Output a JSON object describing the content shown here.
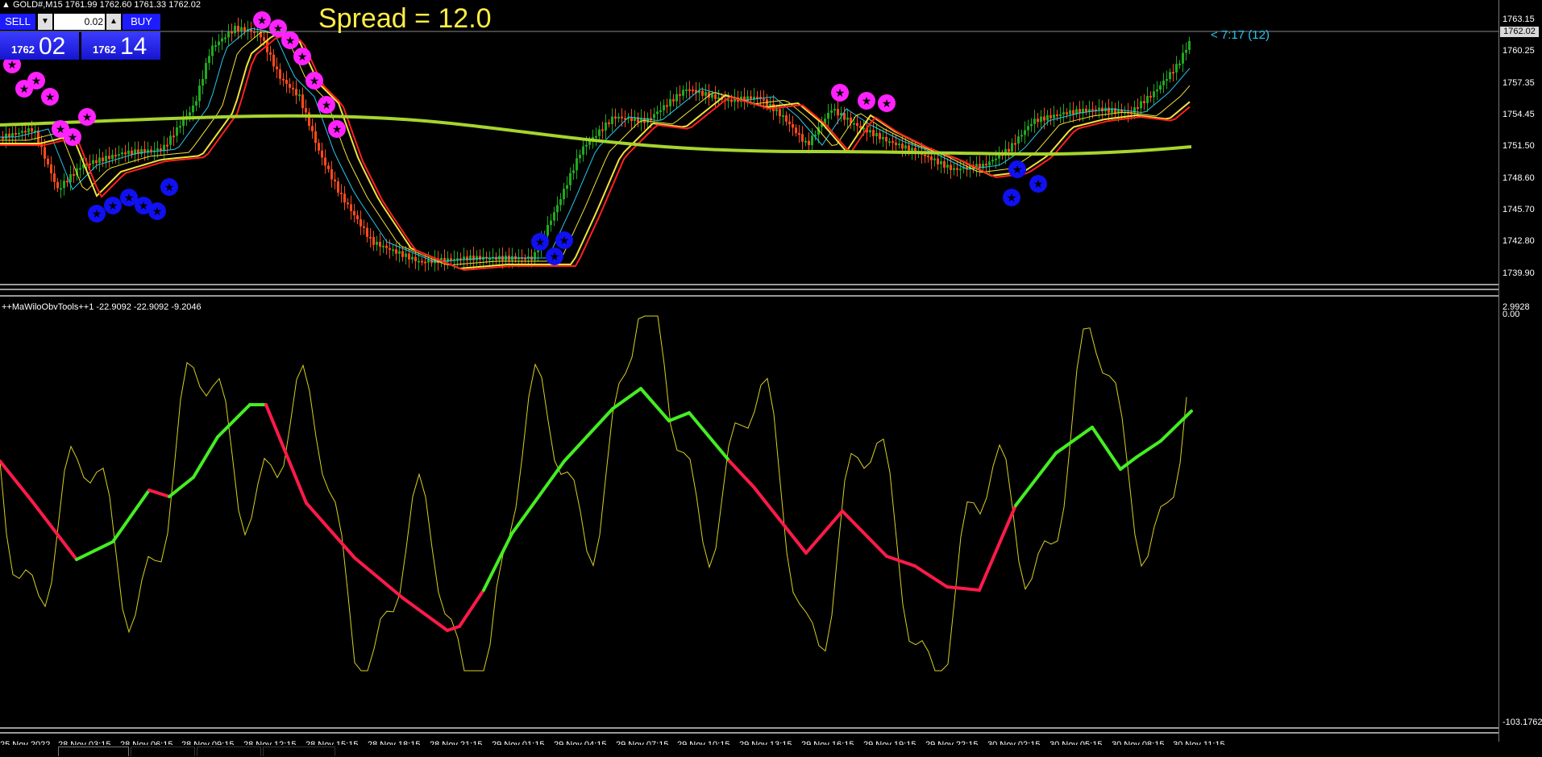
{
  "window": {
    "symbol_title": "GOLD#,M15  1761.99 1762.60 1761.33 1762.02"
  },
  "trade_panel": {
    "sell_label": "SELL",
    "buy_label": "BUY",
    "lot_value": "0.02",
    "bid_prefix": "1762",
    "bid_suffix": "02",
    "ask_prefix": "1762",
    "ask_suffix": "14"
  },
  "spread_text": "Spread = 12.0",
  "timer_text": "< 7:17 (12)",
  "current_price_label": "1762.02",
  "price_axis": [
    "1763.15",
    "1760.25",
    "1757.35",
    "1754.45",
    "1751.50",
    "1748.60",
    "1745.70",
    "1742.80",
    "1739.90"
  ],
  "indicator": {
    "title": "++MaWiloObvTools++1 -22.9092 -22.9092 -9.2046",
    "axis_top": "2.9928",
    "axis_zero": "0.00",
    "axis_bottom": "-103.1762"
  },
  "time_axis": [
    "25 Nov 2022",
    "28 Nov 03:15",
    "28 Nov 06:15",
    "28 Nov 09:15",
    "28 Nov 12:15",
    "28 Nov 15:15",
    "28 Nov 18:15",
    "28 Nov 21:15",
    "29 Nov 01:15",
    "29 Nov 04:15",
    "29 Nov 07:15",
    "29 Nov 10:15",
    "29 Nov 13:15",
    "29 Nov 16:15",
    "29 Nov 19:15",
    "29 Nov 22:15",
    "30 Nov 02:15",
    "30 Nov 05:15",
    "30 Nov 08:15",
    "30 Nov 11:15"
  ],
  "colors": {
    "ma_long": "#a6d52e",
    "ma_red": "#ff2020",
    "ma_yellow": "#f2e23a",
    "ma_cyan": "#27c8f0",
    "up_candle": "#1faa1f",
    "down_candle": "#ff4a1a",
    "signal_sell": "#ff22ff",
    "signal_buy": "#1010f0",
    "osc_up": "#44ee22",
    "osc_down": "#ff1a4a",
    "osc_thin": "#d8d020"
  }
}
